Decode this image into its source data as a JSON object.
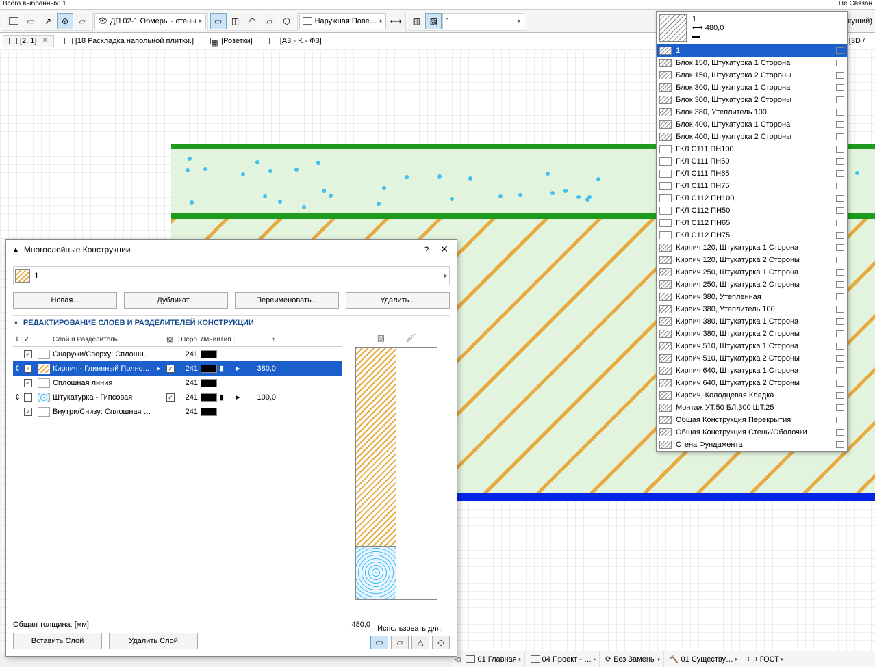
{
  "info_bar": {
    "left": "Всего выбранных: 1",
    "right": "Не Связан"
  },
  "toolbar": {
    "view_name": "ДП 02-1 Обмеры - стены",
    "surface_label": "Наружная Пове…",
    "composite_value": "1",
    "right_status": "(екущий)"
  },
  "tabs": [
    {
      "label": "[2. 1]",
      "active": true
    },
    {
      "label": "[18 Раскладка напольной плитки.]",
      "active": false
    },
    {
      "label": "[Розетки]",
      "active": false
    },
    {
      "label": "[A3 - K - Ф3]",
      "active": false
    }
  ],
  "tab_right": "[3D /",
  "composite": {
    "name": "1",
    "thickness": "480,0",
    "items": [
      "1",
      "Блок 150, Штукатурка 1 Сторона",
      "Блок 150, Штукатурка 2 Стороны",
      "Блок 300, Штукатурка 1 Сторона",
      "Блок 300, Штукатурка 2 Стороны",
      "Блок 380, Утеплитель 100",
      "Блок 400, Штукатурка 1 Сторона",
      "Блок 400, Штукатурка 2 Стороны",
      "ГКЛ С111 ПН100",
      "ГКЛ С111 ПН50",
      "ГКЛ С111 ПН65",
      "ГКЛ С111 ПН75",
      "ГКЛ С112 ПН100",
      "ГКЛ С112 ПН50",
      "ГКЛ С112 ПН65",
      "ГКЛ С112 ПН75",
      "Кирпич 120, Штукатурка 1 Сторона",
      "Кирпич 120, Штукатурка 2 Стороны",
      "Кирпич 250, Штукатурка 1 Сторона",
      "Кирпич 250, Штукатурка 2 Стороны",
      "Кирпич 380, Утепленная",
      "Кирпич 380, Утеплитель 100",
      "Кирпич 380, Штукатурка 1 Сторона",
      "Кирпич 380, Штукатурка 2 Стороны",
      "Кирпич 510, Штукатурка 1 Сторона",
      "Кирпич 510, Штукатурка 2 Стороны",
      "Кирпич 640, Штукатурка 1 Сторона",
      "Кирпич 640, Штукатурка 2 Стороны",
      "Кирпич, Колодцевая Кладка",
      "Монтаж УТ.50 БЛ.300 ШТ.25",
      "Общая Конструкция Перекрытия",
      "Общая Конструкция Стены/Оболочки",
      "Стена Фундамента"
    ]
  },
  "dialog": {
    "title": "Многослойные Конструкции",
    "name_value": "1",
    "btn_new": "Новая...",
    "btn_dup": "Дубликат...",
    "btn_ren": "Переименовать...",
    "btn_del": "Удалить...",
    "section": "РЕДАКТИРОВАНИЕ СЛОЕВ И РАЗДЕЛИТЕЛЕЙ КОНСТРУКЦИИ",
    "columns": {
      "layer": "Слой и Разделитель",
      "pen": "Перо",
      "line": "Линии",
      "type": "Тип",
      "thick": "↕"
    },
    "rows": [
      {
        "name": "Снаружи/Сверху: Сплошн...",
        "pen": "241",
        "selected": false,
        "chk": true,
        "core": false,
        "thick": ""
      },
      {
        "name": "Кирпич - Глиняный Полно...",
        "pen": "241",
        "selected": true,
        "chk": true,
        "core": true,
        "thick": "380,0"
      },
      {
        "name": "Сплошная линия",
        "pen": "241",
        "selected": false,
        "chk": true,
        "core": false,
        "thick": ""
      },
      {
        "name": "Штукатурка - Гипсовая",
        "pen": "241",
        "selected": false,
        "chk": false,
        "core": true,
        "thick": "100,0"
      },
      {
        "name": "Внутри/Снизу: Сплошная …",
        "pen": "241",
        "selected": false,
        "chk": true,
        "core": false,
        "thick": ""
      }
    ],
    "total_label": "Общая толщина: [мм]",
    "total_value": "480,0",
    "use_label": "Использовать для:",
    "btn_insert": "Вставить Слой",
    "btn_remove": "Удалить Слой"
  },
  "status": {
    "items": [
      "01 Главная",
      "04 Проект - …",
      "Без Замены",
      "01 Существу…",
      "ГОСТ"
    ]
  }
}
